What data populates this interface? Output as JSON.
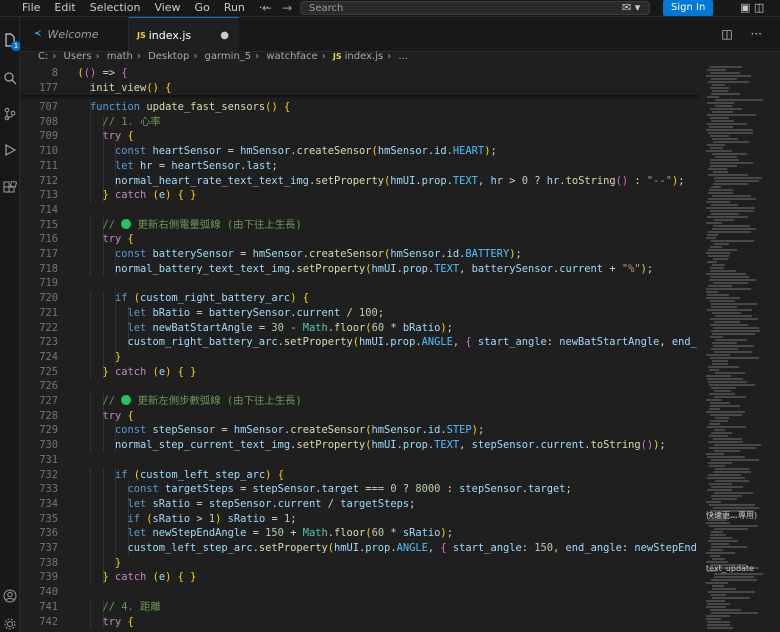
{
  "menu": [
    "File",
    "Edit",
    "Selection",
    "View",
    "Go",
    "Run",
    "···"
  ],
  "search": {
    "placeholder": "Search"
  },
  "signin": "Sign In",
  "tabs": [
    {
      "label": "Welcome",
      "icon": "vscode-icon"
    },
    {
      "label": "index.js",
      "icon": "JS",
      "modified": "●"
    }
  ],
  "breadcrumb": [
    "C:",
    "Users",
    "math",
    "Desktop",
    "garmin_5",
    "watchface",
    "index.js",
    "..."
  ],
  "activity_badge": "1",
  "sticky": [
    {
      "num": "8",
      "text": "(() => {"
    },
    {
      "num": "177",
      "text": "init_view() {"
    }
  ],
  "lines": [
    {
      "num": "707",
      "text": "function update_fast_sensors() {"
    },
    {
      "num": "708",
      "text": "// 1. 心率"
    },
    {
      "num": "709",
      "text": "try {"
    },
    {
      "num": "710",
      "text": "const heartSensor = hmSensor.createSensor(hmSensor.id.HEART);"
    },
    {
      "num": "711",
      "text": "let hr = heartSensor.last;"
    },
    {
      "num": "712",
      "text": "normal_heart_rate_text_text_img.setProperty(hmUI.prop.TEXT, hr > 0 ? hr.toString() : \"--\");"
    },
    {
      "num": "713",
      "text": "} catch (e) { }"
    },
    {
      "num": "714",
      "text": ""
    },
    {
      "num": "715",
      "text": "// 🟢 更新右側電量弧線 (由下往上生長)"
    },
    {
      "num": "716",
      "text": "try {"
    },
    {
      "num": "717",
      "text": "const batterySensor = hmSensor.createSensor(hmSensor.id.BATTERY);"
    },
    {
      "num": "718",
      "text": "normal_battery_text_text_img.setProperty(hmUI.prop.TEXT, batterySensor.current + \"%\");"
    },
    {
      "num": "719",
      "text": ""
    },
    {
      "num": "720",
      "text": "if (custom_right_battery_arc) {"
    },
    {
      "num": "721",
      "text": "let bRatio = batterySensor.current / 100;"
    },
    {
      "num": "722",
      "text": "let newBatStartAngle = 30 - Math.floor(60 * bRatio);"
    },
    {
      "num": "723",
      "text": "custom_right_battery_arc.setProperty(hmUI.prop.ANGLE, { start_angle: newBatStartAngle, end_"
    },
    {
      "num": "724",
      "text": "}"
    },
    {
      "num": "725",
      "text": "} catch (e) { }"
    },
    {
      "num": "726",
      "text": ""
    },
    {
      "num": "727",
      "text": "// 🟢 更新左側步數弧線 (由下往上生長)"
    },
    {
      "num": "728",
      "text": "try {"
    },
    {
      "num": "729",
      "text": "const stepSensor = hmSensor.createSensor(hmSensor.id.STEP);"
    },
    {
      "num": "730",
      "text": "normal_step_current_text_img.setProperty(hmUI.prop.TEXT, stepSensor.current.toString());"
    },
    {
      "num": "731",
      "text": ""
    },
    {
      "num": "732",
      "text": "if (custom_left_step_arc) {"
    },
    {
      "num": "733",
      "text": "const targetSteps = stepSensor.target === 0 ? 8000 : stepSensor.target;"
    },
    {
      "num": "734",
      "text": "let sRatio = stepSensor.current / targetSteps;"
    },
    {
      "num": "735",
      "text": "if (sRatio > 1) sRatio = 1;"
    },
    {
      "num": "736",
      "text": "let newStepEndAngle = 150 + Math.floor(60 * sRatio);"
    },
    {
      "num": "737",
      "text": "custom_left_step_arc.setProperty(hmUI.prop.ANGLE, { start_angle: 150, end_angle: newStepEnd"
    },
    {
      "num": "738",
      "text": "}"
    },
    {
      "num": "739",
      "text": "} catch (e) { }"
    },
    {
      "num": "740",
      "text": ""
    },
    {
      "num": "741",
      "text": "// 4. 距離"
    },
    {
      "num": "742",
      "text": "try {"
    }
  ],
  "minimap_labels": [
    "快速更…專用)",
    "text_update"
  ],
  "colors": {
    "accent": "#0078d4",
    "editor_bg": "#1f1f1f",
    "status_green": "#22c55e"
  }
}
